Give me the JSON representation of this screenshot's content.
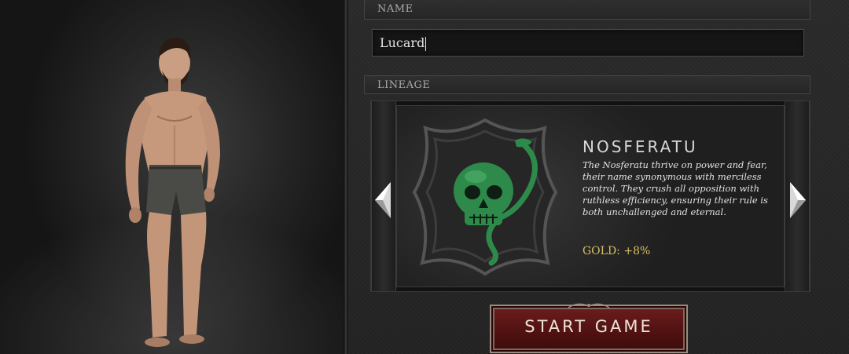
{
  "name_section": {
    "header": "NAME",
    "input_value": "Lucard"
  },
  "lineage_section": {
    "header": "LINEAGE",
    "selected": {
      "name": "NOSFERATU",
      "description": "The Nosferatu thrive on power and fear, their name synonymous with merciless control. They crush all opposition with ruthless efficiency, ensuring their rule is both unchallenged and eternal.",
      "bonus": "GOLD: +8%",
      "emblem_icon": "skull-serpent-emblem-icon"
    },
    "prev_icon": "arrow-left-icon",
    "next_icon": "arrow-right-icon"
  },
  "start_button": {
    "label": "START GAME"
  },
  "colors": {
    "accent_gold": "#d9bf63",
    "button_red": "#5a1414",
    "emblem_green": "#2e8a4a"
  }
}
